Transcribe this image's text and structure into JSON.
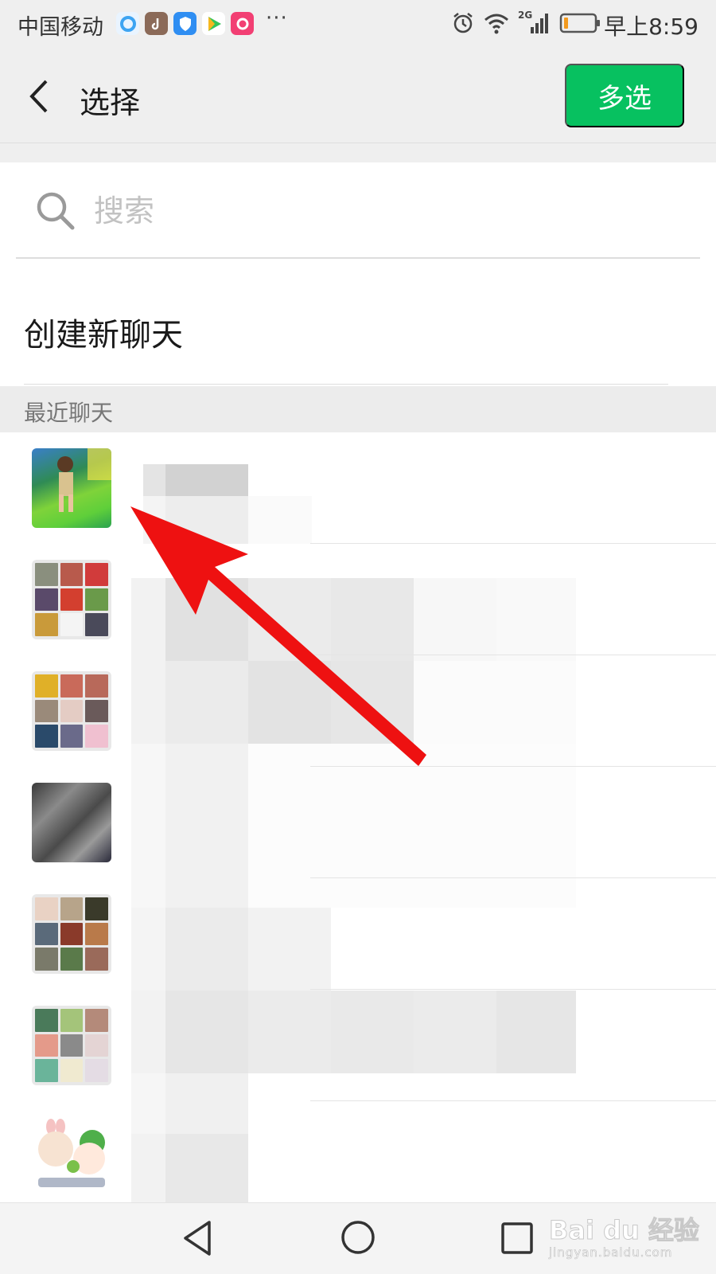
{
  "status_bar": {
    "carrier": "中国移动",
    "dots": "···",
    "time": "早上8:59",
    "network_badge": "2G",
    "app_icons": [
      "browser-icon",
      "tiktok-icon",
      "shield-app-icon",
      "video-app-icon",
      "music-app-icon"
    ],
    "system_icons": [
      "alarm-icon",
      "wifi-icon",
      "signal-icon",
      "battery-icon"
    ],
    "battery_level": 0.15
  },
  "nav": {
    "title": "选择",
    "multi_select_label": "多选",
    "accent_color": "#07c160"
  },
  "search": {
    "placeholder": "搜索",
    "value": ""
  },
  "new_chat": {
    "label": "创建新聊天"
  },
  "recent": {
    "section_label": "最近聊天",
    "chats": [
      {
        "avatar": "photo-child-avatar",
        "name": ""
      },
      {
        "avatar": "group-grid-avatar",
        "name": ""
      },
      {
        "avatar": "group-grid-avatar",
        "name": ""
      },
      {
        "avatar": "photo-rocks-avatar",
        "name": ""
      },
      {
        "avatar": "group-grid-avatar",
        "name": ""
      },
      {
        "avatar": "group-grid-avatar",
        "name": ""
      },
      {
        "avatar": "cartoon-avatar",
        "name": ""
      }
    ]
  },
  "annotation": {
    "arrow_color": "#ee1111"
  },
  "watermark": {
    "brand": "Bai du 经验",
    "url": "jingyan.baidu.com"
  }
}
